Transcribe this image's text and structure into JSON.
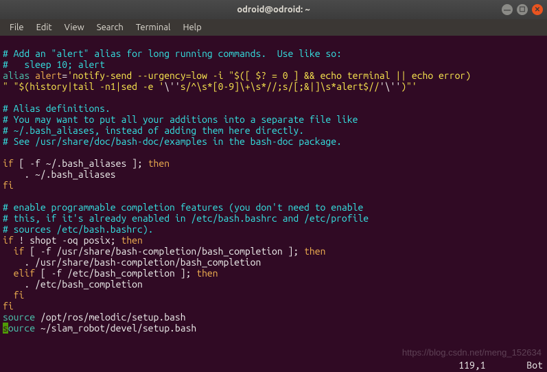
{
  "window": {
    "title": "odroid@odroid: ~"
  },
  "menu": {
    "file": "File",
    "edit": "Edit",
    "view": "View",
    "search": "Search",
    "terminal": "Terminal",
    "help": "Help"
  },
  "code": {
    "l1": "# Add an \"alert\" alias for long running commands.  Use like so:",
    "l2": "#   sleep 10; alert",
    "l3a": "alias ",
    "l3b": "alert",
    "l3c": "=",
    "l3d": "'notify-send --urgency=low -i \"$([ $? = 0 ] && echo terminal || echo error)",
    "l4a": "\" \"$(history|tail -n1|sed -e '",
    "l4b": "\\''",
    "l4c": "s/^\\s*[0-9]\\+\\s*//;s/[;&|]\\s*alert$//",
    "l4d": "'\\''",
    "l4e": ")\"",
    "l4f": "'",
    "l6": "# Alias definitions.",
    "l7": "# You may want to put all your additions into a separate file like",
    "l8": "# ~/.bash_aliases, instead of adding them here directly.",
    "l9": "# See /usr/share/doc/bash-doc/examples in the bash-doc package.",
    "l11a": "if",
    "l11b": " [ -f ~/.bash_aliases ]; ",
    "l11c": "then",
    "l12": "    . ~/.bash_aliases",
    "l13": "fi",
    "l15": "# enable programmable completion features (you don't need to enable",
    "l16": "# this, if it's already enabled in /etc/bash.bashrc and /etc/profile",
    "l17": "# sources /etc/bash.bashrc).",
    "l18a": "if",
    "l18b": " ! shopt -oq posix; ",
    "l18c": "then",
    "l19a": "  if",
    "l19b": " [ -f /usr/share/bash-completion/bash_completion ]; ",
    "l19c": "then",
    "l20": "    . /usr/share/bash-completion/bash_completion",
    "l21a": "  elif",
    "l21b": " [ -f /etc/bash_completion ]; ",
    "l21c": "then",
    "l22": "    . /etc/bash_completion",
    "l23": "  fi",
    "l24": "fi",
    "l25a": "source",
    "l25b": " /opt/ros/melodic/setup.bash",
    "l26cur": "s",
    "l26a": "ource",
    "l26b": " ~/slam_robot/devel/setup.bash"
  },
  "status": {
    "pos": "119,1",
    "loc": "Bot"
  },
  "watermark": "https://blog.csdn.net/meng_152634"
}
